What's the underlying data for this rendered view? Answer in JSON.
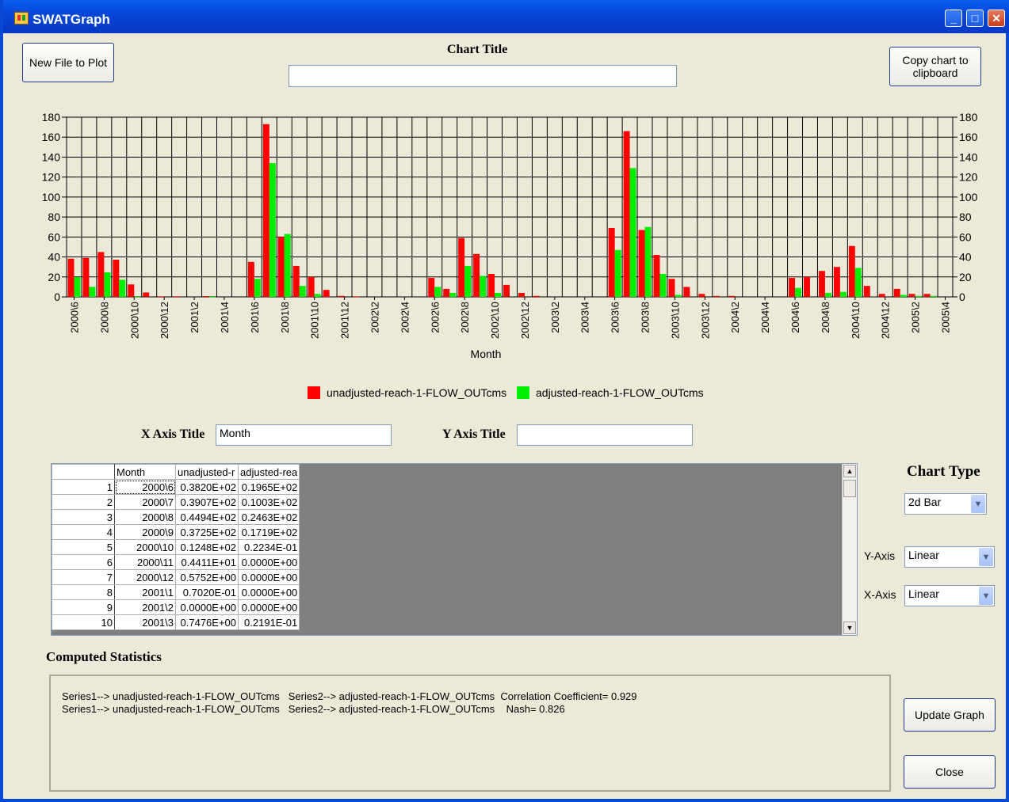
{
  "window": {
    "title": "SWATGraph"
  },
  "buttons": {
    "new_file": "New File to Plot",
    "copy_chart": "Copy chart to clipboard",
    "update_graph": "Update Graph",
    "close": "Close"
  },
  "chart_title_label": "Chart Title",
  "chart_title_value": "",
  "x_axis_title_label": "X Axis Title",
  "x_axis_title_value": "Month",
  "y_axis_title_label": "Y Axis Title",
  "y_axis_title_value": "",
  "chart_type": {
    "label": "Chart Type",
    "value": "2d Bar"
  },
  "y_axis_scale": {
    "label": "Y-Axis",
    "value": "Linear"
  },
  "x_axis_scale": {
    "label": "X-Axis",
    "value": "Linear"
  },
  "statistics": {
    "label": "Computed Statistics",
    "line1": "Series1--> unadjusted-reach-1-FLOW_OUTcms   Series2--> adjusted-reach-1-FLOW_OUTcms  Correlation Coefficient= 0.929",
    "line2": "Series1--> unadjusted-reach-1-FLOW_OUTcms   Series2--> adjusted-reach-1-FLOW_OUTcms    Nash= 0.826"
  },
  "table": {
    "headers": [
      "Month",
      "unadjusted-r",
      "adjusted-rea"
    ],
    "rows": [
      {
        "n": "1",
        "month": "2000\\6",
        "unadj": "0.3820E+02",
        "adj": "0.1965E+02"
      },
      {
        "n": "2",
        "month": "2000\\7",
        "unadj": "0.3907E+02",
        "adj": "0.1003E+02"
      },
      {
        "n": "3",
        "month": "2000\\8",
        "unadj": "0.4494E+02",
        "adj": "0.2463E+02"
      },
      {
        "n": "4",
        "month": "2000\\9",
        "unadj": "0.3725E+02",
        "adj": "0.1719E+02"
      },
      {
        "n": "5",
        "month": "2000\\10",
        "unadj": "0.1248E+02",
        "adj": "0.2234E-01"
      },
      {
        "n": "6",
        "month": "2000\\11",
        "unadj": "0.4411E+01",
        "adj": "0.0000E+00"
      },
      {
        "n": "7",
        "month": "2000\\12",
        "unadj": "0.5752E+00",
        "adj": "0.0000E+00"
      },
      {
        "n": "8",
        "month": "2001\\1",
        "unadj": "0.7020E-01",
        "adj": "0.0000E+00"
      },
      {
        "n": "9",
        "month": "2001\\2",
        "unadj": "0.0000E+00",
        "adj": "0.0000E+00"
      },
      {
        "n": "10",
        "month": "2001\\3",
        "unadj": "0.7476E+00",
        "adj": "0.2191E-01"
      }
    ]
  },
  "colors": {
    "unadjusted": "#ff0000",
    "adjusted": "#00ee00"
  },
  "chart_data": {
    "type": "bar",
    "title": "",
    "xlabel": "Month",
    "ylabel": "",
    "ylim": [
      0,
      180
    ],
    "yticks": [
      0,
      20,
      40,
      60,
      80,
      100,
      120,
      140,
      160,
      180
    ],
    "grid": true,
    "legend": "bottom",
    "categories": [
      "2000\\6",
      "2000\\7",
      "2000\\8",
      "2000\\9",
      "2000\\10",
      "2000\\11",
      "2000\\12",
      "2001\\1",
      "2001\\2",
      "2001\\3",
      "2001\\4",
      "2001\\5",
      "2001\\6",
      "2001\\7",
      "2001\\8",
      "2001\\9",
      "2001\\10",
      "2001\\11",
      "2001\\12",
      "2002\\1",
      "2002\\2",
      "2002\\3",
      "2002\\4",
      "2002\\5",
      "2002\\6",
      "2002\\7",
      "2002\\8",
      "2002\\9",
      "2002\\10",
      "2002\\11",
      "2002\\12",
      "2003\\1",
      "2003\\2",
      "2003\\3",
      "2003\\4",
      "2003\\5",
      "2003\\6",
      "2003\\7",
      "2003\\8",
      "2003\\9",
      "2003\\10",
      "2003\\11",
      "2003\\12",
      "2004\\1",
      "2004\\2",
      "2004\\3",
      "2004\\4",
      "2004\\5",
      "2004\\6",
      "2004\\7",
      "2004\\8",
      "2004\\9",
      "2004\\10",
      "2004\\11",
      "2004\\12",
      "2005\\1",
      "2005\\2",
      "2005\\3",
      "2005\\4"
    ],
    "xtick_labels": [
      "2000\\6",
      "2000\\8",
      "2000\\10",
      "2000\\12",
      "2001\\2",
      "2001\\4",
      "2001\\6",
      "2001\\8",
      "2001\\10",
      "2001\\12",
      "2002\\2",
      "2002\\4",
      "2002\\6",
      "2002\\8",
      "2002\\10",
      "2002\\12",
      "2003\\2",
      "2003\\4",
      "2003\\6",
      "2003\\8",
      "2003\\10",
      "2003\\12",
      "2004\\2",
      "2004\\4",
      "2004\\6",
      "2004\\8",
      "2004\\10",
      "2004\\12",
      "2005\\2",
      "2005\\4"
    ],
    "series": [
      {
        "name": "unadjusted-reach-1-FLOW_OUTcms",
        "values": [
          38.2,
          39.07,
          44.94,
          37.25,
          12.48,
          4.41,
          0.58,
          0.07,
          0,
          0.75,
          0,
          0,
          35,
          173,
          60,
          31,
          20,
          7,
          1,
          0.5,
          0,
          0,
          0,
          0,
          19,
          8,
          59,
          43,
          23,
          12,
          4,
          1,
          0,
          0,
          0,
          0,
          69,
          166,
          67,
          42,
          18,
          10,
          3,
          1,
          1,
          0,
          0,
          0,
          19,
          20,
          26,
          30,
          51,
          11,
          3,
          8,
          3,
          3,
          0
        ]
      },
      {
        "name": "adjusted-reach-1-FLOW_OUTcms",
        "values": [
          19.65,
          10.03,
          24.63,
          17.19,
          0.02,
          0,
          0,
          0,
          0,
          0.02,
          0,
          0,
          18,
          134,
          63,
          11,
          3,
          0,
          0,
          0,
          0,
          0,
          0,
          0,
          10,
          4,
          31,
          21,
          4,
          0,
          0,
          0,
          0,
          0,
          0,
          0,
          47,
          129,
          70,
          23,
          2,
          0,
          0,
          0,
          0,
          0,
          0,
          0,
          9,
          0,
          4,
          5,
          29,
          0,
          0,
          2,
          1,
          1,
          0
        ]
      }
    ]
  }
}
